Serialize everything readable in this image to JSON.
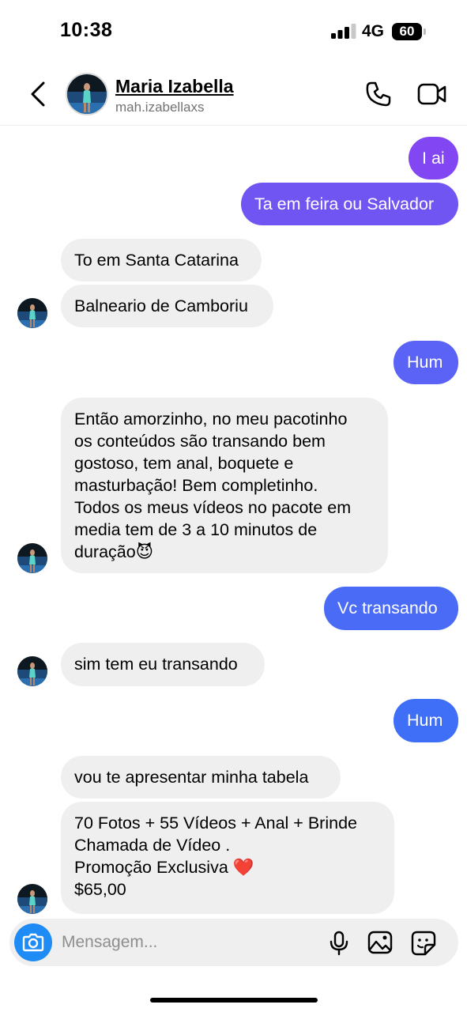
{
  "status": {
    "time": "10:38",
    "network": "4G",
    "battery": "60"
  },
  "header": {
    "name": "Maria Izabella",
    "handle": "mah.izabellaxs"
  },
  "messages": [
    {
      "text": "I ai"
    },
    {
      "text": "Ta em feira ou Salvador"
    },
    {
      "text": "To em Santa Catarina"
    },
    {
      "text": "Balneario de Camboriu"
    },
    {
      "text": "Hum"
    },
    {
      "text": "Então amorzinho, no meu pacotinho\nos conteúdos são transando bem\ngostoso, tem anal, boquete e\nmasturbação! Bem completinho.\nTodos os meus vídeos no pacote em\nmedia tem de 3 a 10 minutos de\nduração😈"
    },
    {
      "text": "Vc transando"
    },
    {
      "text": "sim tem eu transando"
    },
    {
      "text": "Hum"
    },
    {
      "text": "vou te apresentar minha tabela"
    },
    {
      "text": "70 Fotos + 55 Vídeos + Anal + Brinde\nChamada de Vídeo .\nPromoção Exclusiva ❤️\n$65,00"
    }
  ],
  "composer": {
    "placeholder": "Mensagem..."
  },
  "colors": {
    "outgoing_purple": "#7b4cf4",
    "outgoing_blue": "#3b6ef8",
    "incoming": "#efefef",
    "accent": "#1f8cf5"
  }
}
